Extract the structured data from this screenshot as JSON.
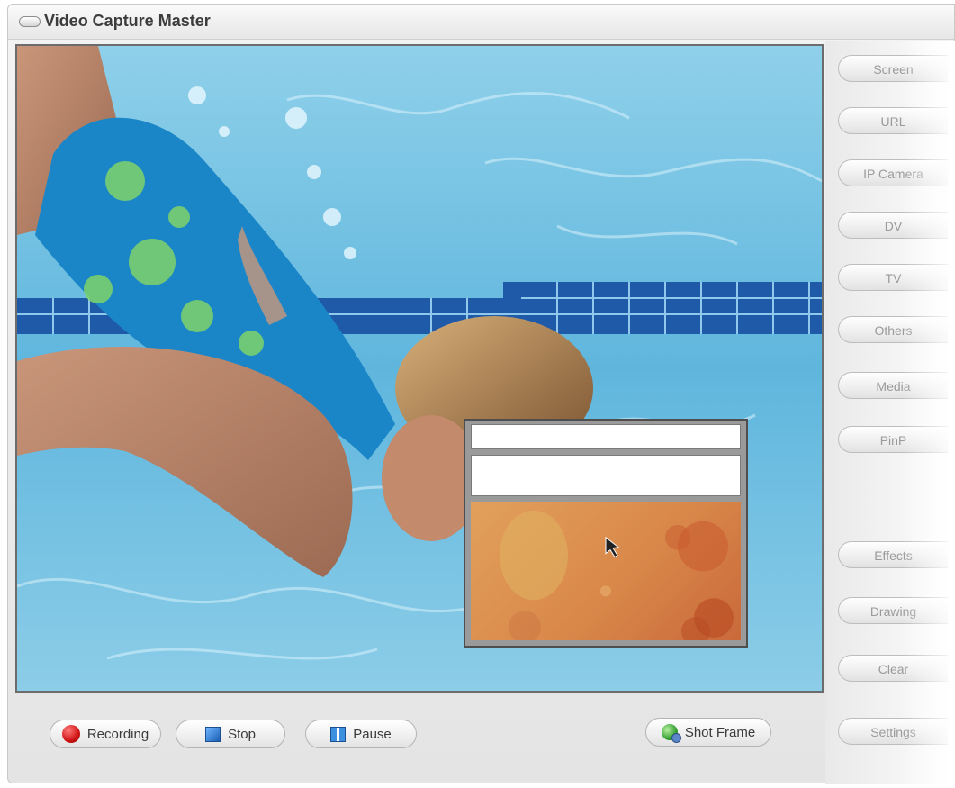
{
  "window": {
    "title": "Video Capture Master"
  },
  "sidebar": {
    "items": [
      {
        "label": "Screen",
        "icon": null
      },
      {
        "label": "URL",
        "icon": null
      },
      {
        "label": "IP Camera",
        "icon": null
      },
      {
        "label": "DV",
        "icon": null
      },
      {
        "label": "TV",
        "icon": null
      },
      {
        "label": "Others",
        "icon": null
      },
      {
        "label": "Media",
        "icon": null
      },
      {
        "label": "PinP",
        "icon": null
      },
      {
        "label": "Effects",
        "icon": null
      },
      {
        "label": "Drawing",
        "icon": null
      },
      {
        "label": "Clear",
        "icon": null
      },
      {
        "label": "Settings",
        "icon": null
      }
    ]
  },
  "controls": {
    "recording": {
      "label": "Recording",
      "icon": "record-dot-icon",
      "color": "#d01414"
    },
    "stop": {
      "label": "Stop",
      "icon": "stop-square-icon",
      "color": "#1a5fb4"
    },
    "pause": {
      "label": "Pause",
      "icon": "pause-icon",
      "color": "#3d8fe0"
    },
    "shot_frame": {
      "label": "Shot Frame",
      "icon": "camera-shot-icon",
      "color": "#2c9a2c"
    }
  },
  "preview": {
    "description_icon": "live-video-preview",
    "pip": {
      "content_colors": [
        "#e2a05c",
        "#c9693a"
      ]
    }
  },
  "colors": {
    "water": "#5fb6dd",
    "pool_tile": "#1f5aa8",
    "swimsuit": "#1a86c8"
  }
}
